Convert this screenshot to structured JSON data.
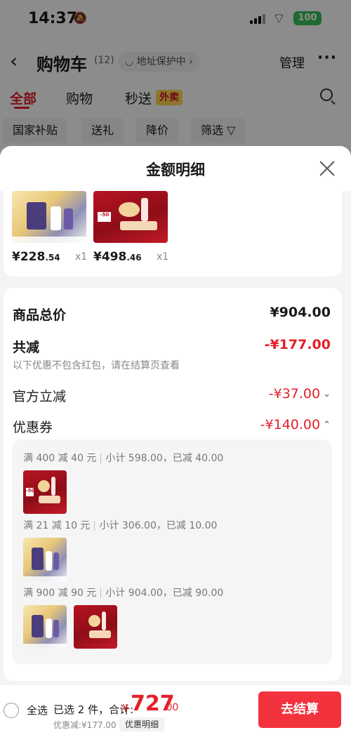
{
  "status_bar": {
    "time": "14:37",
    "battery": "100"
  },
  "nav": {
    "title": "购物车",
    "count": "(12)",
    "address_protect": "地址保护中",
    "manage": "管理",
    "more": "···"
  },
  "tabs": {
    "all": "全部",
    "shopping": "购物",
    "instant": "秒送",
    "waimai_badge": "外卖"
  },
  "chips": [
    "国家补贴",
    "送礼",
    "降价",
    "筛选 ▽"
  ],
  "sheet": {
    "title": "金额明细",
    "items": [
      {
        "price_int": "¥228",
        "price_dec": ".54",
        "qty": "x1"
      },
      {
        "price_int": "¥498",
        "price_dec": ".46",
        "qty": "x1"
      }
    ],
    "summary": {
      "total_label": "商品总价",
      "total_value": "¥904.00",
      "reduce_label": "共减",
      "reduce_value": "-¥177.00",
      "reduce_note": "以下优惠不包含红包，请在结算页查看",
      "official_label": "官方立减",
      "official_value": "-¥37.00",
      "coupon_label": "优惠券",
      "coupon_value": "-¥140.00"
    },
    "coupons": [
      {
        "rule": "满 400 减 40 元",
        "detail": "小计 598.00，已减 40.00"
      },
      {
        "rule": "满 21 减 10 元",
        "detail": "小计 306.00，已减 10.00"
      },
      {
        "rule": "满 900 减 90 元",
        "detail": "小计 904.00，已减 90.00"
      }
    ]
  },
  "bottom_bar": {
    "select_all": "全选",
    "selected": "已选 2 件，合计:",
    "currency": "¥",
    "total_int": "727",
    "total_dec": ".00",
    "saved": "优惠减:¥177.00",
    "detail_button": "优惠明细",
    "checkout": "去结算"
  },
  "colors": {
    "accent": "#e4202b",
    "checkout": "#f2323d",
    "badge": "#ffd84d",
    "battery": "#39c25a"
  },
  "icons": [
    "back-icon",
    "shield-icon",
    "more-icon",
    "search-icon",
    "filter-icon",
    "close-icon",
    "chevron-down-icon",
    "chevron-up-icon",
    "radio-icon"
  ]
}
